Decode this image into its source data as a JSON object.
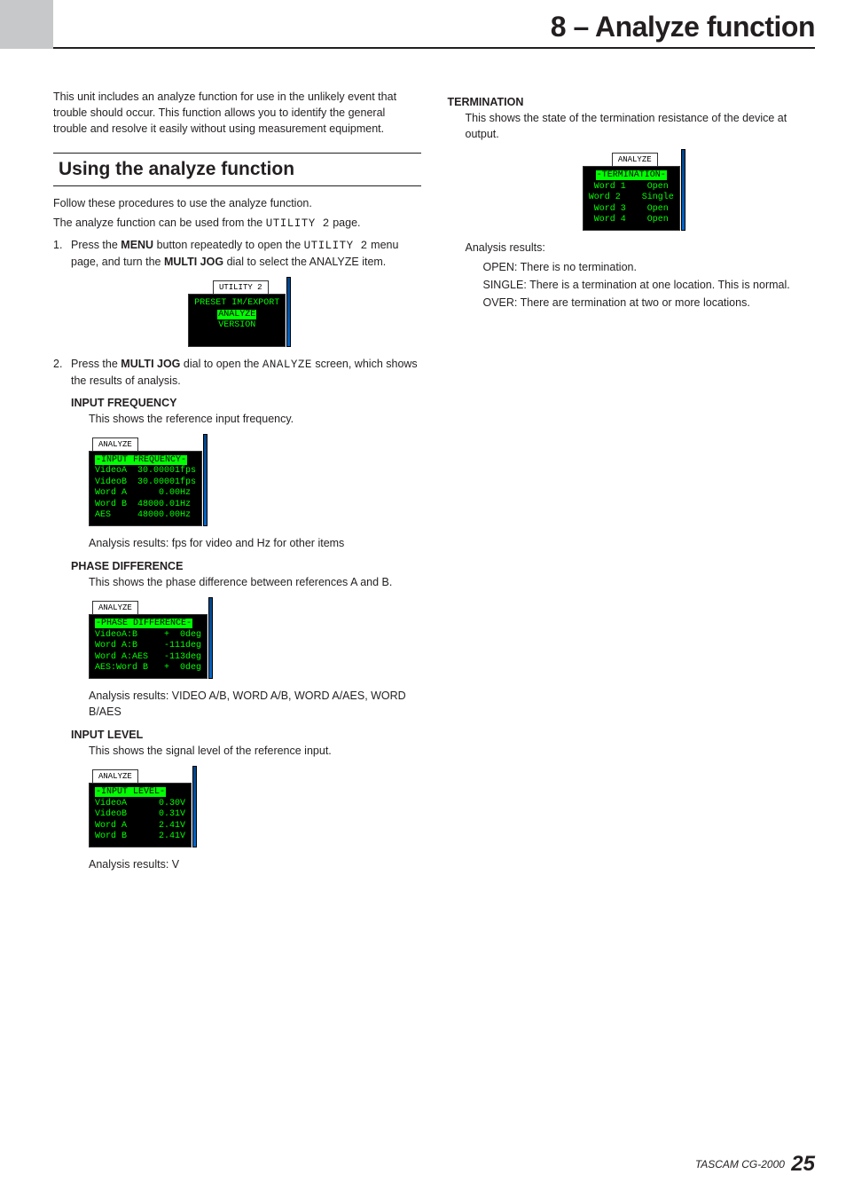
{
  "chapter_title": "8 – Analyze function",
  "intro": "This unit includes an analyze function for use in the unlikely event that trouble should occur. This function allows you to identify the general trouble and resolve it easily without using measurement equipment.",
  "section_heading": "Using the analyze function",
  "follow": "Follow these procedures to use the analyze function.",
  "canbe_pre": "The analyze function can be used from the ",
  "canbe_mono": "UTILITY 2",
  "canbe_post": " page.",
  "step1": {
    "num": "1.",
    "t1": "Press the ",
    "b1": "MENU",
    "t2": " button repeatedly to open the ",
    "m1": "UTILITY 2",
    "t3": " menu page, and turn the ",
    "b2": "MULTI JOG",
    "t4": " dial to select the ANALYZE item."
  },
  "lcd1_tab": "UTILITY 2",
  "lcd1_l1": "PRESET IM/EXPORT",
  "lcd1_l2": "ANALYZE",
  "lcd1_l3": "VERSION",
  "step2": {
    "num": "2.",
    "t1": "Press the ",
    "b1": "MULTI JOG",
    "t2": " dial to open the ",
    "m1": "ANALYZE",
    "t3": " screen, which shows the results of analysis."
  },
  "freq": {
    "h": "INPUT FREQUENCY",
    "desc": "This shows the reference input frequency.",
    "tab": "ANALYZE",
    "l1": "-INPUT FREQUENCY-",
    "l2": "VideoA  30.00001fps",
    "l3": "VideoB  30.00001fps",
    "l4": "Word A      0.00Hz",
    "l5": "Word B  48000.01Hz",
    "l6": "AES     48000.00Hz",
    "res": "Analysis results: fps for video and Hz for other items"
  },
  "phase": {
    "h": "PHASE DIFFERENCE",
    "desc": "This shows the phase difference between references A and B.",
    "tab": "ANALYZE",
    "l1": "-PHASE DIFFERENCE-",
    "l2": "VideoA:B     +  0deg",
    "l3": "Word A:B     -111deg",
    "l4": "Word A:AES   -113deg",
    "l5": "AES:Word B   +  0deg",
    "res": "Analysis results: VIDEO A/B, WORD A/B, WORD A/AES, WORD B/AES"
  },
  "level": {
    "h": "INPUT LEVEL",
    "desc": "This shows the signal level of the reference input.",
    "tab": "ANALYZE",
    "l1": "-INPUT LEVEL-",
    "l2": "VideoA      0.30V",
    "l3": "VideoB      0.31V",
    "l4": "Word A      2.41V",
    "l5": "Word B      2.41V",
    "res": "Analysis results: V"
  },
  "term": {
    "h": "TERMINATION",
    "desc": "This shows the state of the termination resistance of the device at output.",
    "tab": "ANALYZE",
    "l1": "-TERMINATION-",
    "l2": "Word 1    Open",
    "l3": "Word 2    Single",
    "l4": "Word 3    Open",
    "l5": "Word 4    Open",
    "res_label": "Analysis results:",
    "r1": "OPEN: There is no termination.",
    "r2": "SINGLE: There is a termination at one location. This is normal.",
    "r3": "OVER: There are termination at two or more locations."
  },
  "footer_model": "TASCAM CG-2000",
  "footer_page": "25"
}
